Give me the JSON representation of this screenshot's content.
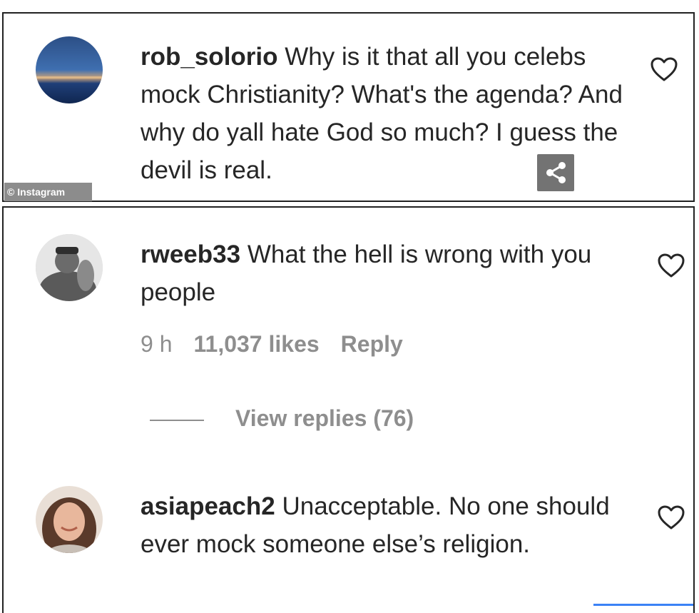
{
  "watermark": "© Instagram",
  "comments": [
    {
      "username": "rob_solorio",
      "text": " Why is it that all you celebs mock Christianity? What's the agenda? And why do yall hate God so much? I guess the devil is real."
    },
    {
      "username": "rweeb33",
      "text": " What the hell is wrong with you people",
      "time": "9 h",
      "likes": "11,037 likes",
      "reply": "Reply",
      "view_replies": "View replies (76)"
    },
    {
      "username": "asiapeach2",
      "text": " Unacceptable. No one should ever mock someone else’s religion."
    }
  ],
  "icons": {
    "like": "heart-outline-icon",
    "share": "share-icon"
  },
  "colors": {
    "text": "#262626",
    "muted": "#8e8e8e",
    "border": "#222222"
  }
}
